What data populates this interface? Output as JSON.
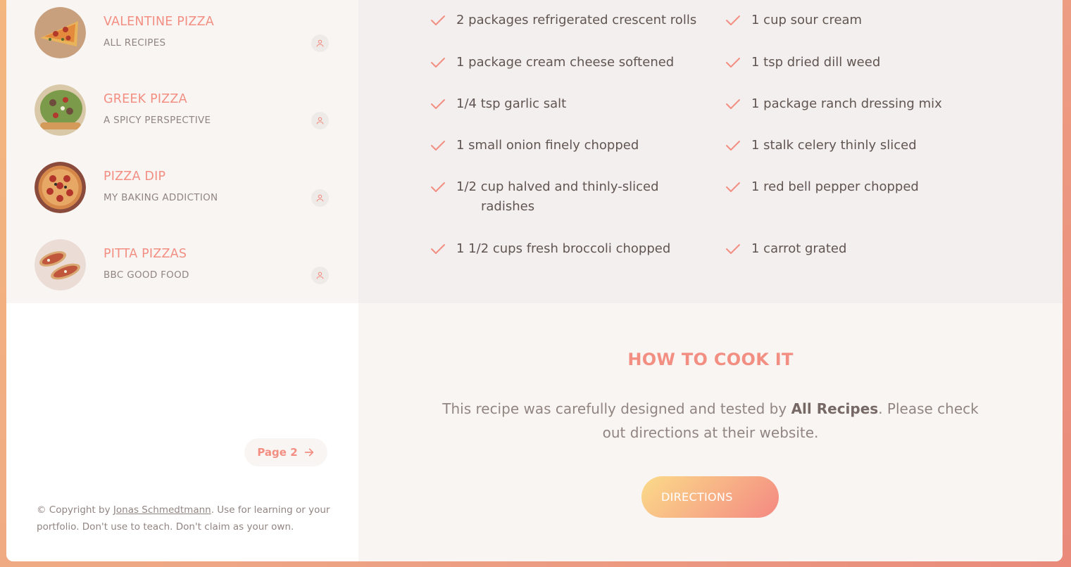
{
  "colors": {
    "accent": "#f38e82",
    "text_muted": "#918581",
    "text_dark": "#615551"
  },
  "search_results": [
    {
      "title": "VALENTINE PIZZA",
      "publisher": "ALL RECIPES",
      "icon": "user-icon"
    },
    {
      "title": "GREEK PIZZA",
      "publisher": "A SPICY PERSPECTIVE",
      "icon": "user-icon"
    },
    {
      "title": "PIZZA DIP",
      "publisher": "MY BAKING ADDICTION",
      "icon": "user-icon"
    },
    {
      "title": "PITTA PIZZAS",
      "publisher": "BBC GOOD FOOD",
      "icon": "user-icon"
    }
  ],
  "pagination": {
    "next_label": "Page 2",
    "icon": "arrow-right-icon"
  },
  "copyright": {
    "prefix": "© Copyright by ",
    "author": "Jonas Schmedtmann",
    "suffix": ". Use for learning or your portfolio. Don't use to teach. Don't claim as your own."
  },
  "ingredients": [
    "2 packages refrigerated crescent rolls",
    "1 cup sour cream",
    "1 package cream cheese softened",
    "1 tsp dried dill weed",
    "1/4 tsp garlic salt",
    "1 package ranch dressing mix",
    "1 small onion finely chopped",
    "1 stalk celery thinly sliced",
    "1/2 cup halved and thinly-sliced",
    "radishes",
    "1 red bell pepper chopped",
    "1 1/2 cups fresh broccoli chopped",
    "1 carrot grated"
  ],
  "cook": {
    "title": "HOW TO COOK IT",
    "text_prefix": "This recipe was carefully designed and tested by ",
    "publisher": "All Recipes",
    "text_suffix": ". Please check out directions at their website.",
    "button": "DIRECTIONS"
  }
}
